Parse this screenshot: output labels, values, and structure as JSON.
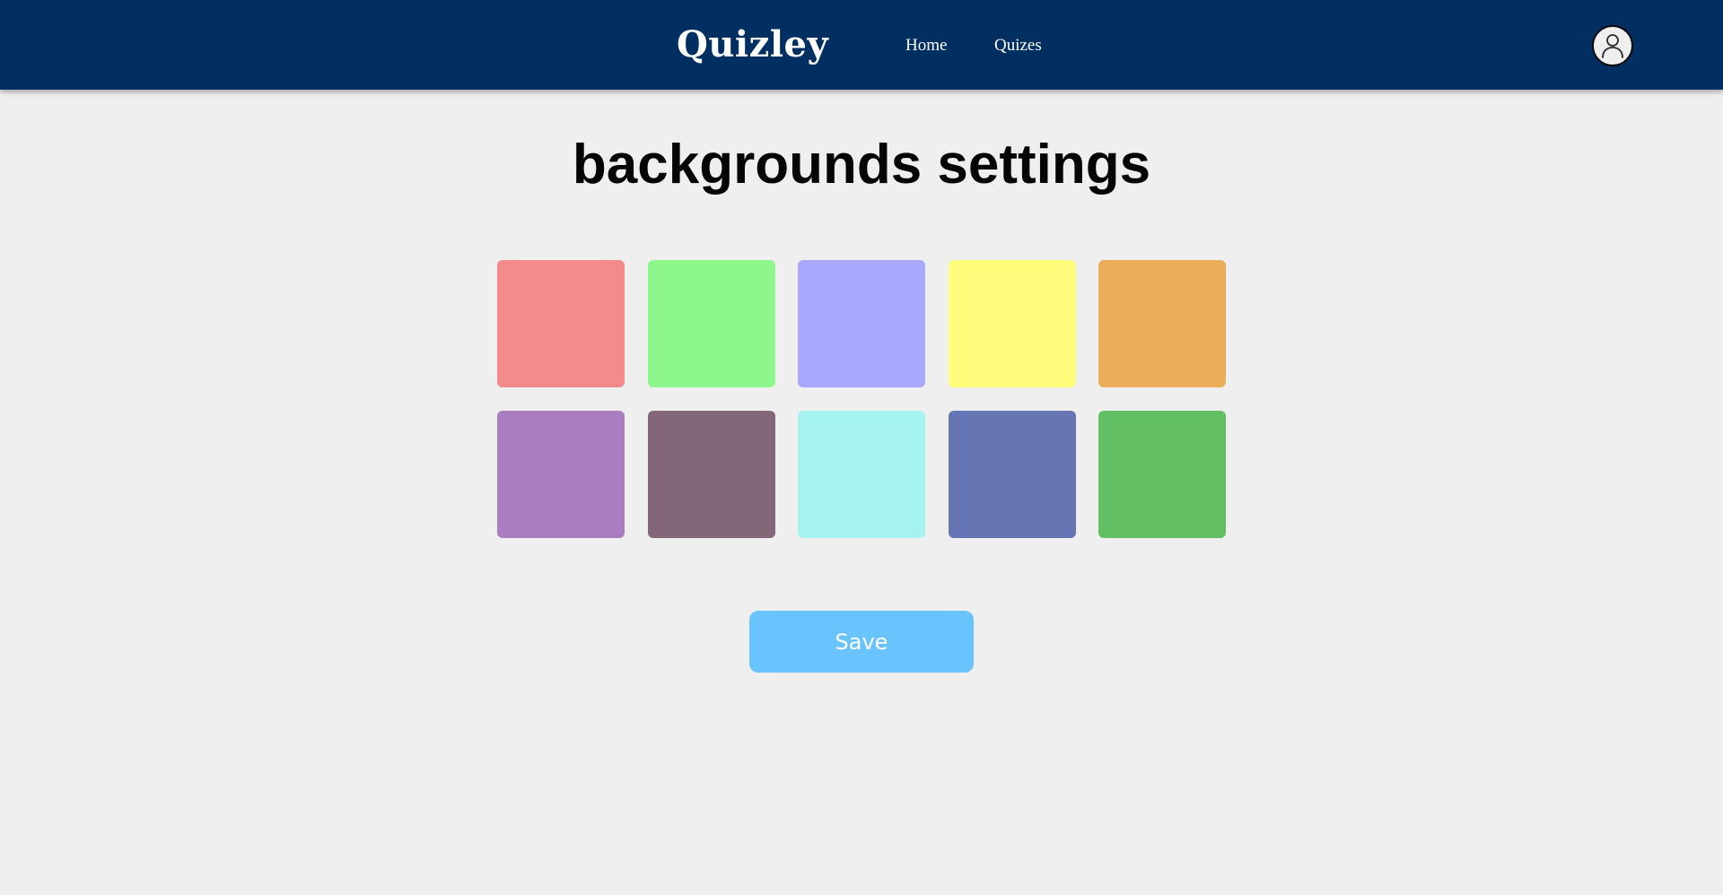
{
  "header": {
    "brand": "Quizley",
    "nav": [
      {
        "label": "Home"
      },
      {
        "label": "Quizes"
      }
    ],
    "avatar_icon": "user-icon",
    "background_color": "#012f62"
  },
  "main": {
    "title": "backgrounds settings",
    "swatches": [
      {
        "color": "#f38b8d"
      },
      {
        "color": "#8ef78c"
      },
      {
        "color": "#a7a8fb"
      },
      {
        "color": "#fefd7c"
      },
      {
        "color": "#eaad5a"
      },
      {
        "color": "#aa7fc1"
      },
      {
        "color": "#836778"
      },
      {
        "color": "#a5f3f1"
      },
      {
        "color": "#6676b4"
      },
      {
        "color": "#63bf63"
      }
    ],
    "save_label": "Save",
    "save_color": "#69c3fd"
  }
}
